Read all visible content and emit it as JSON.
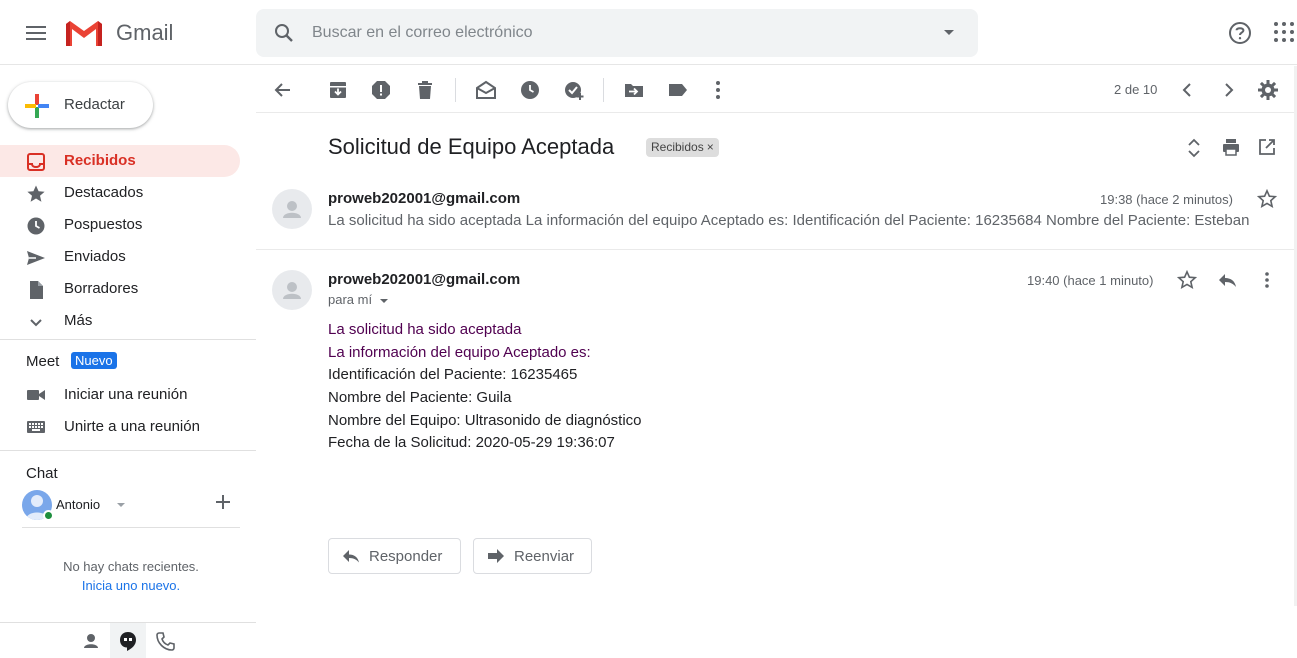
{
  "app": {
    "logo_text": "Gmail",
    "search_placeholder": "Buscar en el correo electrónico"
  },
  "sidebar": {
    "compose_label": "Redactar",
    "items": [
      {
        "label": "Recibidos",
        "icon": "inbox-icon",
        "active": true
      },
      {
        "label": "Destacados",
        "icon": "star-icon"
      },
      {
        "label": "Pospuestos",
        "icon": "clock-icon"
      },
      {
        "label": "Enviados",
        "icon": "send-icon"
      },
      {
        "label": "Borradores",
        "icon": "draft-icon"
      },
      {
        "label": "Más",
        "icon": "chevron-down-icon"
      }
    ],
    "meet": {
      "title": "Meet",
      "badge": "Nuevo",
      "start_meeting": "Iniciar una reunión",
      "join_meeting": "Unirte a una reunión"
    },
    "chat": {
      "title": "Chat",
      "user_name": "Antonio",
      "no_chats": "No hay chats recientes.",
      "start_new": "Inicia uno nuevo."
    }
  },
  "toolbar": {
    "pager": "2 de 10"
  },
  "thread": {
    "subject": "Solicitud de Equipo Aceptada",
    "label_chip": "Recibidos",
    "label_chip_close": "×",
    "messages": [
      {
        "sender": "proweb202001@gmail.com",
        "time": "19:38 (hace 2 minutos)",
        "snippet": "La solicitud ha sido aceptada La información del equipo Aceptado es: Identificación del Paciente: 16235684 Nombre del Paciente: Esteban"
      },
      {
        "sender": "proweb202001@gmail.com",
        "time": "19:40 (hace 1 minuto)",
        "to": "para mí",
        "body": [
          "La solicitud ha sido aceptada",
          "La información del equipo Aceptado es:",
          "Identificación del Paciente: 16235465",
          "Nombre del Paciente: Guila",
          "Nombre del Equipo: Ultrasonido de diagnóstico",
          "Fecha de la Solicitud: 2020-05-29 19:36:07"
        ]
      }
    ],
    "reply_label": "Responder",
    "forward_label": "Reenviar"
  },
  "colors": {
    "accent_red": "#d93025",
    "active_bg": "#fce8e6",
    "link_blue": "#1a73e8",
    "quoted_purple": "#500050"
  }
}
